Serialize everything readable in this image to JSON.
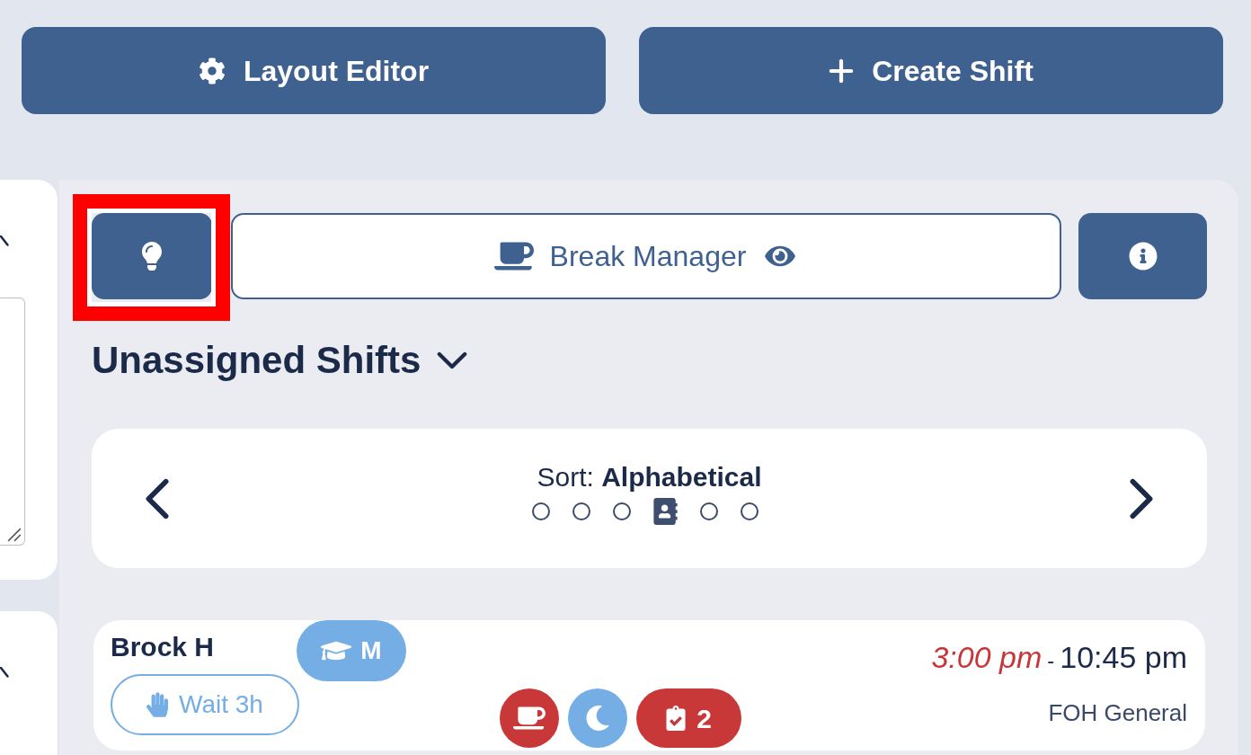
{
  "toolbar": {
    "buttons": [
      {
        "kind": "layout",
        "label": "Layout Editor"
      },
      {
        "kind": "create",
        "label": "Create Shift"
      }
    ]
  },
  "main": {
    "hint_button": {
      "highlighted": true
    },
    "break_manager": {
      "label": "Break Manager"
    },
    "section": {
      "title": "Unassigned Shifts"
    },
    "sort": {
      "label": "Sort:",
      "value": "Alphabetical",
      "pages": [
        {
          "selected": false
        },
        {
          "selected": false
        },
        {
          "selected": false
        },
        {
          "selected": true
        },
        {
          "selected": false
        },
        {
          "selected": false
        }
      ]
    },
    "shifts": [
      {
        "name": "Brock H",
        "badge": "M",
        "wait": "Wait 3h",
        "start": "3:00 pm",
        "start_late": true,
        "separator": "-",
        "end": "10:45 pm",
        "position": "FOH General",
        "indicators": [
          {
            "kind": "break",
            "color": "#c93838"
          },
          {
            "kind": "night",
            "color": "#74aee4"
          },
          {
            "kind": "tasks",
            "label": "2",
            "color": "#c93838"
          }
        ]
      }
    ]
  }
}
